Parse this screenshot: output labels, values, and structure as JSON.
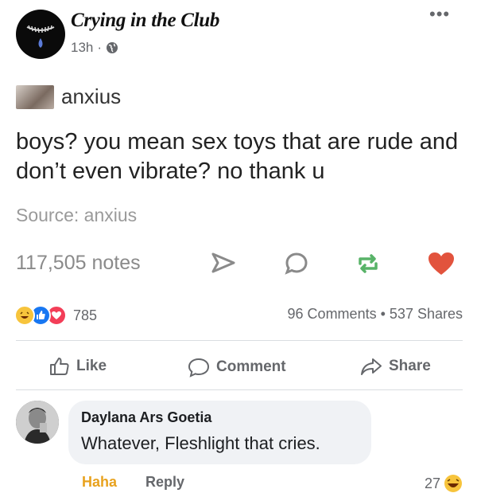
{
  "post": {
    "page_name": "Crying in the Club",
    "time": "13h",
    "separator": "·",
    "privacy_icon": "globe-icon",
    "more_label": "•••"
  },
  "tumblr": {
    "username": "anxius",
    "text": "boys? you mean sex toys that are rude and don’t even vibrate? no thank u",
    "source": "Source: anxius",
    "notes": "117,505 notes",
    "icons": [
      "share-arrow-icon",
      "reply-bubble-icon",
      "reblog-icon",
      "heart-icon"
    ],
    "heart_color": "#e2533d",
    "reblog_color": "#58b368"
  },
  "reactions": {
    "count": "785",
    "icons": [
      "haha-icon",
      "like-icon",
      "love-icon"
    ],
    "comments": "96 Comments",
    "separator": "•",
    "shares": "537 Shares"
  },
  "actions": {
    "like": "Like",
    "comment": "Comment",
    "share": "Share"
  },
  "comment": {
    "author": "Daylana Ars Goetia",
    "text": "Whatever, Fleshlight that cries.",
    "haha": "Haha",
    "reply": "Reply",
    "reaction_count": "27",
    "haha_color": "#e8a21e"
  }
}
